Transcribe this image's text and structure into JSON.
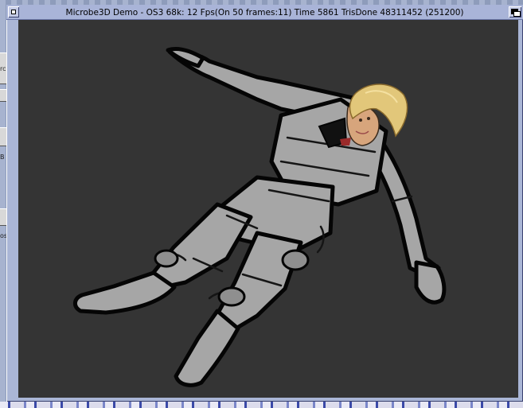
{
  "window": {
    "title": "Microbe3D Demo - OS3 68k: 12 Fps(On 50 frames:11) Time 5861 TrisDone 48311452 (251200)"
  },
  "gadgets": {
    "close": "close-gadget",
    "depth": "depth-gadget"
  },
  "background_window_glyphs": [
    "rc",
    "B",
    "os"
  ],
  "colors": {
    "viewport_background": "#343434",
    "model_suit": "#a6a6a6",
    "model_outline": "#050505",
    "model_hair": "#e2c77a",
    "titlebar": "#a9b4d8"
  }
}
